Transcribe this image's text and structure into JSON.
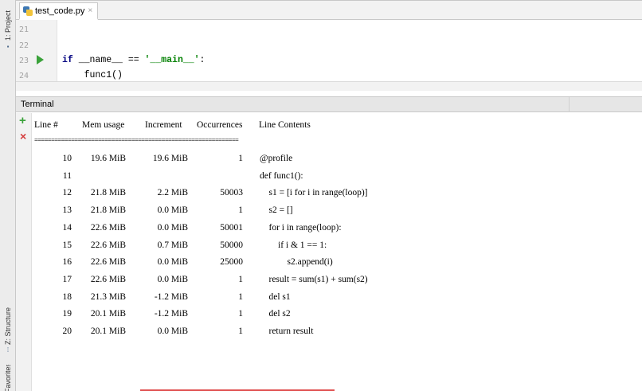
{
  "left_strip": {
    "project_tab": "1: Project",
    "structure_tab": "Z: Structure",
    "favorites_tab": "Favorites"
  },
  "editor": {
    "tab": {
      "filename": "test_code.py",
      "close": "×"
    },
    "lines": [
      {
        "num": "21",
        "code": ""
      },
      {
        "num": "22",
        "code": ""
      },
      {
        "num": "23",
        "kw": "if",
        "rest1": " __name__ == ",
        "str": "'__main__'",
        "rest2": ":"
      },
      {
        "num": "24",
        "code": "    func1()"
      }
    ]
  },
  "terminal": {
    "title": "Terminal",
    "add_icon": "+",
    "close_icon": "×",
    "headers": {
      "line": "Line #",
      "mem": "Mem usage",
      "inc": "Increment",
      "occ": "Occurrences",
      "contents": "Line Contents"
    },
    "separator": "=============================================================",
    "rows": [
      {
        "line": "10",
        "mem": "19.6 MiB",
        "inc": "19.6 MiB",
        "occ": "1",
        "contents": "@profile"
      },
      {
        "line": "11",
        "mem": "",
        "inc": "",
        "occ": "",
        "contents": "def func1():"
      },
      {
        "line": "12",
        "mem": "21.8 MiB",
        "inc": "2.2 MiB",
        "occ": "50003",
        "contents": "    s1 = [i for i in range(loop)]"
      },
      {
        "line": "13",
        "mem": "21.8 MiB",
        "inc": "0.0 MiB",
        "occ": "1",
        "contents": "    s2 = []"
      },
      {
        "line": "14",
        "mem": "22.6 MiB",
        "inc": "0.0 MiB",
        "occ": "50001",
        "contents": "    for i in range(loop):"
      },
      {
        "line": "15",
        "mem": "22.6 MiB",
        "inc": "0.7 MiB",
        "occ": "50000",
        "contents": "        if i & 1 == 1:"
      },
      {
        "line": "16",
        "mem": "22.6 MiB",
        "inc": "0.0 MiB",
        "occ": "25000",
        "contents": "            s2.append(i)"
      },
      {
        "line": "17",
        "mem": "22.6 MiB",
        "inc": "0.0 MiB",
        "occ": "1",
        "contents": "    result = sum(s1) + sum(s2)"
      },
      {
        "line": "18",
        "mem": "21.3 MiB",
        "inc": "-1.2 MiB",
        "occ": "1",
        "contents": "    del s1"
      },
      {
        "line": "19",
        "mem": "20.1 MiB",
        "inc": "-1.2 MiB",
        "occ": "1",
        "contents": "    del s2"
      },
      {
        "line": "20",
        "mem": "20.1 MiB",
        "inc": "0.0 MiB",
        "occ": "1",
        "contents": "    return result"
      }
    ]
  },
  "colors": {
    "run_arrow": "#3aa23a",
    "keyword": "#000080",
    "string": "#008000",
    "close_icon": "#d43b3b"
  }
}
